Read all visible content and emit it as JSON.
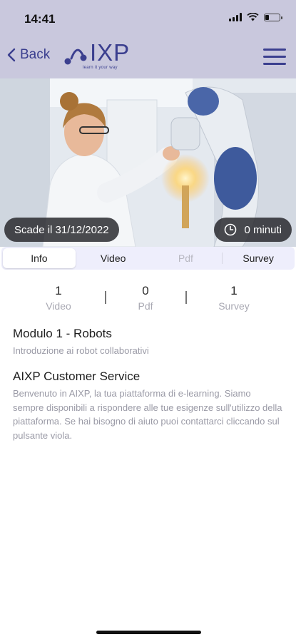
{
  "status_bar": {
    "time": "14:41"
  },
  "nav": {
    "back_label": "Back",
    "logo_text": "IXP",
    "logo_tagline": "learn it your way"
  },
  "hero": {
    "expires_label": "Scade il 31/12/2022",
    "duration_label": "0 minuti"
  },
  "tabs": [
    {
      "label": "Info",
      "state": "active"
    },
    {
      "label": "Video",
      "state": "normal"
    },
    {
      "label": "Pdf",
      "state": "disabled"
    },
    {
      "label": "Survey",
      "state": "normal"
    }
  ],
  "stats": [
    {
      "value": "1",
      "label": "Video"
    },
    {
      "value": "0",
      "label": "Pdf"
    },
    {
      "value": "1",
      "label": "Survey"
    }
  ],
  "module": {
    "title": "Modulo 1 - Robots",
    "subtitle": "Introduzione ai robot collaborativi"
  },
  "support": {
    "title": "AIXP Customer Service",
    "body": "Benvenuto in AIXP, la tua piattaforma di e-learning. Siamo sempre disponibili a rispondere alle tue esigenze sull'utilizzo della piattaforma. Se hai bisogno di aiuto puoi contattarci cliccando sul pulsante viola."
  },
  "colors": {
    "header_bg": "#c9c8dd",
    "brand": "#3b3f8f",
    "tab_bg": "#eeeefc"
  }
}
